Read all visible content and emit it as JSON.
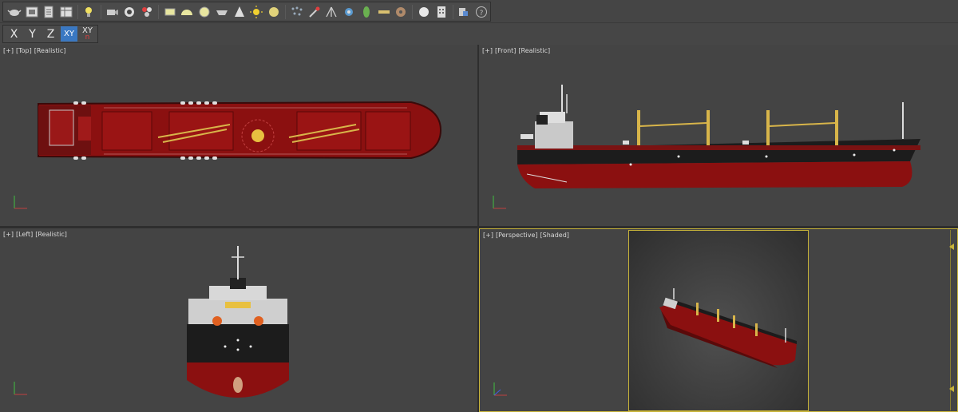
{
  "toolbar": {
    "icons": [
      "teapot-render-icon",
      "render-frame-icon",
      "render-setup-icon",
      "render-table-icon",
      "light-icon",
      "camera-icon",
      "material-editor-icon",
      "render-production-icon",
      "plane-icon",
      "dome-icon",
      "sphere-icon",
      "bowl-icon",
      "cone-icon",
      "sun-icon",
      "disc-icon",
      "scatter-icon",
      "paint-icon",
      "tripod-icon",
      "atom-icon",
      "leaf-icon",
      "ruler-icon",
      "gear-sphere-icon",
      "ball-icon",
      "calculator-icon",
      "layers-icon",
      "help-icon"
    ]
  },
  "axis_constraints": {
    "x_label": "X",
    "y_label": "Y",
    "z_label": "Z",
    "xy_label": "XY",
    "xy_snap_label": "XY",
    "xy_snap_sub": "n"
  },
  "viewports": {
    "top": {
      "plus": "[+]",
      "view": "[Top]",
      "shading": "[Realistic]"
    },
    "front": {
      "plus": "[+]",
      "view": "[Front]",
      "shading": "[Realistic]"
    },
    "left": {
      "plus": "[+]",
      "view": "[Left]",
      "shading": "[Realistic]"
    },
    "perspective": {
      "plus": "[+]",
      "view": "[Perspective]",
      "shading": "[Shaded]"
    }
  },
  "colors": {
    "hull_red": "#8b1010",
    "hull_black": "#1c1c1c",
    "crane_yellow": "#d8b54a",
    "frame_yellow": "#c8b43a",
    "active_axis": "#3a78c2"
  }
}
